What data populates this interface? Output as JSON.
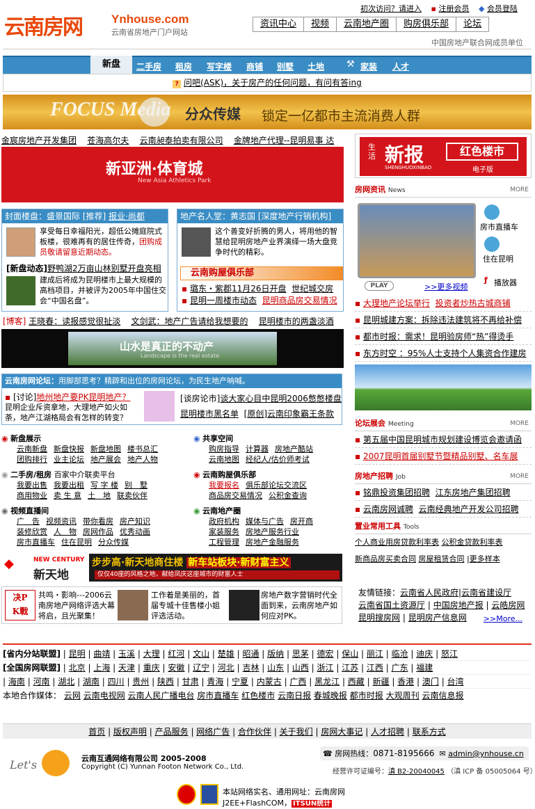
{
  "header": {
    "logo_text": "云南房网",
    "brand": "Ynhouse.com",
    "tagline": "云南省房地产门户网站",
    "top_links": [
      "初次访问？请进入",
      "注册会员",
      "会员登陆"
    ],
    "nav": [
      "资讯中心",
      "视频",
      "云南地产圈",
      "购房俱乐部",
      "论坛"
    ],
    "member_text": "中国房地产联合网成员单位"
  },
  "channels": {
    "current": "新盘",
    "items": [
      "二手房",
      "租房",
      "写字楼",
      "商铺",
      "别墅",
      "土地",
      "家装",
      "人才"
    ]
  },
  "ask": "问吧(ASK)，关于房产的任何问题，有问有答ing",
  "focus_banner": {
    "logo": "FOCUS Media",
    "name": "分众传媒",
    "slogan": "锁定一亿都市主流消费人群"
  },
  "company_links": [
    "金宸房地产开发集团",
    "苍海高尔夫",
    "云南昶泰拍卖有限公司",
    "金牌地产代理--昆明易事 达"
  ],
  "ad_banner1": {
    "brand": "新亚洲·体育城",
    "sub": "New Asia Athletics Park"
  },
  "cover": {
    "head": "封面楼盘：盛景国际",
    "head_links": [
      "[推荐]",
      "报业·尚都"
    ],
    "text": "享受每日幸福阳光，超低公摊庭院式板楼，很难再有的居住传奇，",
    "text_red": "团购成员敬请留意近期动态。",
    "news_title": "[新盘动态]",
    "news_link": "野鸭湖2万亩山林别墅开盘亮相",
    "news_text": "建成后将成为昆明楼市上最大规模的高档项目，并被评为2005年中国住交会“中国名盘”。"
  },
  "people": {
    "head": "地产名人堂：黄志国",
    "head_sub": "[深度地产行销机构]",
    "text": "这个善变好折腾的男人，将用他的智慧给昆明房地产业界演绎一场大盘竞争时代的精彩。",
    "club_title": "云南购屋俱乐部",
    "club_links": [
      "璐东・紫郡11月26日开盘",
      "世纪城交房",
      "昆明一周楼市动态",
      "昆明商品房交易情况"
    ]
  },
  "blog": {
    "label": "[博客]",
    "links": [
      "王晓春：读报感觉很扯淡",
      "文剑武：地产广告请给我想要的",
      "昆明楼市的两盏淡酒"
    ]
  },
  "ad_banner2": {
    "text": "山水是真正的不动产",
    "sub": "Landscape is the real estate"
  },
  "forum": {
    "head": "云南房网论坛：",
    "head_sub": "用脚部思考？精辟和出位的房网论坛，为民生地产呐喊。",
    "topic_tag": "[讨论]",
    "topic": "地州地产要PK昆明地产？",
    "topic_text": "昆明企业斥资拿地，大理地产如火如荼，地产江湖格局会有怎样的转变？",
    "links": [
      "[谈房论市]",
      "谈大家心目中昆明2006憋憋楼盘",
      "昆明楼市黑名单",
      "[原创]云南印象霸王条款"
    ]
  },
  "sections": [
    {
      "title": "新盘展示",
      "sub": "",
      "rows": [
        [
          "云南新盘",
          "新盘快报",
          "新盘地图",
          "楼书总汇"
        ],
        [
          "团购排行",
          "业主论坛",
          "地产展会",
          "地产人物"
        ]
      ]
    },
    {
      "title": "共享空间",
      "sub": "",
      "rows": [
        [
          "购房指导",
          "计算器",
          "房地产酷站"
        ],
        [
          "云南地图",
          "经纪人/估价师考试"
        ]
      ]
    },
    {
      "title": "二手房/租房",
      "sub": "百家中介联卖平台",
      "rows": [
        [
          "我要出售",
          "我要出租",
          "写 字 楼",
          "别　墅"
        ],
        [
          "商用物业",
          "卖 生 意",
          "土　地",
          "联卖伙伴"
        ]
      ]
    },
    {
      "title": "云南购屋俱乐部",
      "sub": "",
      "rows": [
        [
          "我要报名",
          "俱乐部论坛交流区"
        ],
        [
          "商品房交易情况",
          "公积金查询"
        ]
      ]
    },
    {
      "title": "视频直播间",
      "sub": "",
      "rows": [
        [
          "广　告",
          "视频资讯",
          "带你看房",
          "房产知识"
        ],
        [
          "装修欣赏",
          "人　物",
          "房网作品",
          "优秀动画"
        ],
        [
          "房市直播车",
          "住在昆明",
          "分众传媒"
        ]
      ]
    },
    {
      "title": "云南地产圈",
      "sub": "",
      "rows": [
        [
          "政府机构",
          "媒体与广告",
          "房开商"
        ],
        [
          "家装服务",
          "房地产服务行业"
        ],
        [
          "工程管理",
          "房地产金融服务"
        ]
      ]
    }
  ],
  "newcentury": {
    "en": "NEW CENTURY",
    "cn": "新天地",
    "slogan": "步步高·新天地商住楼",
    "slogan2": "新车站板块·新财富主义",
    "sub": "仅仅40座的风格之地，献给凤庆这座城市的财富人士"
  },
  "promos": [
    {
      "text": "共鸣・影响---2006云南房地产网络评选大幕将启，且光聚集！"
    },
    {
      "text": "工作着是美丽的，首届专城十佳售楼小姐评选活动。"
    },
    {
      "text": "房地产数字营销时代全面到来，云南房地产如何应对PK。"
    }
  ],
  "right": {
    "newspaper": {
      "name": "新报",
      "pre": "生活",
      "pinyin": "SHENGHUOXINBAO",
      "red": "红色楼市",
      "sub": "电子版"
    },
    "news_head": "房网资讯",
    "news_en": "News",
    "more": "MORE",
    "video_side": [
      "房市直播车",
      "住在昆明"
    ],
    "play": "PLAY",
    "more_video": ">>更多视频",
    "player": "播放器",
    "news": [
      {
        "a": "大理地产论坛举行",
        "b": "投资者炒热古城商铺"
      },
      {
        "a": "昆明城建方案：拆除违法建筑将不再给补偿"
      },
      {
        "a": "都市时报：需求！昆明验房师“热”得烫手"
      },
      {
        "a": "东方时空 ：95%人士支持个人集资合作建房"
      }
    ],
    "forum_head": "论坛展会",
    "forum_en": "Meeting",
    "forum": [
      "第五届中国昆明城市规划建设博览会邀请函",
      "2007昆明首届别墅节暨精品别墅、名车展"
    ],
    "job_head": "房地产招聘",
    "job_en": "Job",
    "jobs": [
      [
        "铭鼎投资集团招聘",
        "江东房地产集团招聘"
      ],
      [
        "云南房网诚聘",
        "云南经典地产开发公司招聘"
      ]
    ],
    "tool_head": "置业常用工具",
    "tool_en": "Tools",
    "tools": [
      "个人商业用房贷款利率表",
      "公积金贷款利率表",
      "新商品房买卖合同",
      "房屋租赁合同",
      "更多样本"
    ]
  },
  "friends": {
    "label": "友情链接：",
    "links": [
      "云南省人民政府",
      "云南省建设厅",
      "云南省国土资源厅",
      "中国房地产报",
      "云皓房网",
      "昆明搜房网",
      "昆明房产信息网"
    ],
    "more": ">>More..."
  },
  "regions": {
    "prov_label": "[省内分站联盟]",
    "prov": [
      "昆明",
      "曲靖",
      "玉溪",
      "大理",
      "红河",
      "文山",
      "楚雄",
      "昭通",
      "版纳",
      "思茅",
      "德宏",
      "保山",
      "丽江",
      "临沧",
      "迪庆",
      "怒江"
    ],
    "nat_label": "[全国房网联盟]",
    "nat": [
      "北京",
      "上海",
      "天津",
      "重庆",
      "安徽",
      "辽宁",
      "河北",
      "吉林",
      "山东",
      "山西",
      "浙江",
      "江苏",
      "江西",
      "广东",
      "福建",
      "海南",
      "河南",
      "湖北",
      "湖南",
      "四川",
      "贵州",
      "陕西",
      "甘肃",
      "青海",
      "宁夏",
      "内蒙古",
      "广西",
      "黑龙江",
      "西藏",
      "新疆",
      "香港",
      "澳门",
      "台湾"
    ],
    "media_label": "本地合作媒体：",
    "media": [
      "云网",
      "云南电视网",
      "云南人民广播电台",
      "房市直播车",
      "红色楼市",
      "云南日报",
      "春城晚报",
      "都市时报",
      "大观周刊",
      "云南信息报"
    ]
  },
  "footer": {
    "nav": [
      "首页",
      "版权声明",
      "产品服务",
      "网络广告",
      "合作伙伴",
      "关于我们",
      "房网大事记",
      "人才招聘",
      "联系方式"
    ],
    "company": "云南互通网络有限公司 2005-2008",
    "copyright": "Copyright (C) Yunnan Footon Network Co., Ltd.",
    "hotline_label": "房网热线：",
    "hotline": "0871-8195666",
    "email": "admin@ynhouse.cn",
    "license": "经营许可证编号：",
    "license_no": "滇 B2-20040045",
    "icp": "（滇 ICP 备 05005064 号）",
    "realname": "本站网络实名、通用网址：云南房网",
    "tech": "J2EE+FlashCOM，",
    "stat": "ITSUN统计"
  }
}
